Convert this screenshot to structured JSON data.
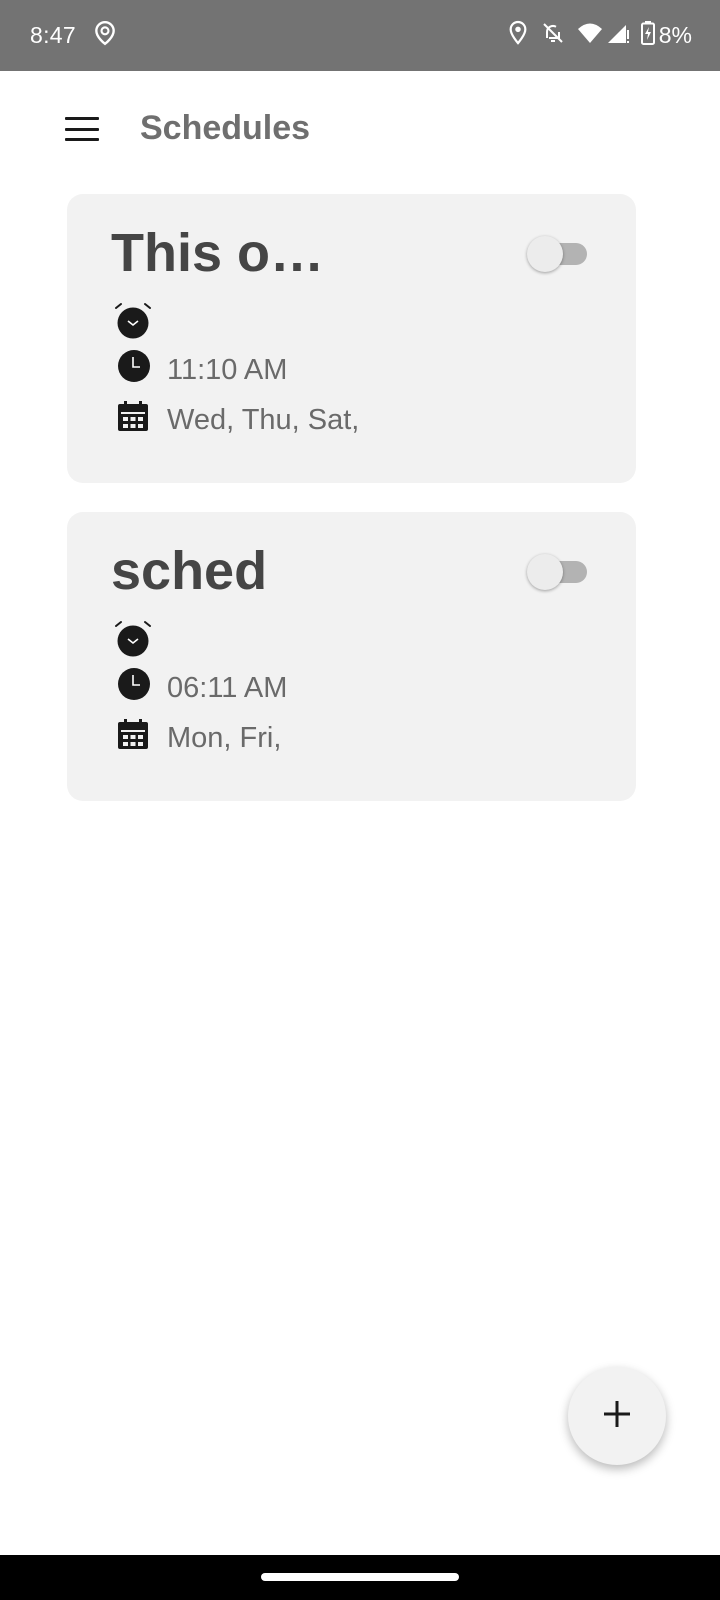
{
  "status_bar": {
    "time": "8:47",
    "battery_percent": "8%",
    "icons": [
      "alarm-location-icon",
      "location-icon",
      "notifications-off-icon",
      "wifi-icon",
      "signal-icon",
      "battery-charging-icon"
    ]
  },
  "app_bar": {
    "title": "Schedules",
    "menu_icon": "hamburger-menu-icon"
  },
  "schedules": [
    {
      "title": "This o…",
      "enabled": false,
      "time": "11:10 AM",
      "days": "Wed, Thu, Sat,"
    },
    {
      "title": "sched",
      "enabled": false,
      "time": "06:11 AM",
      "days": "Mon, Fri,"
    }
  ],
  "fab": {
    "icon": "plus-icon"
  },
  "colors": {
    "status_bar": "#737373",
    "card_background": "#f2f2f2",
    "title_text": "#454545",
    "app_title": "#6f6f6f",
    "secondary_text": "#6a6a6a",
    "icon": "#1a1a1a"
  }
}
